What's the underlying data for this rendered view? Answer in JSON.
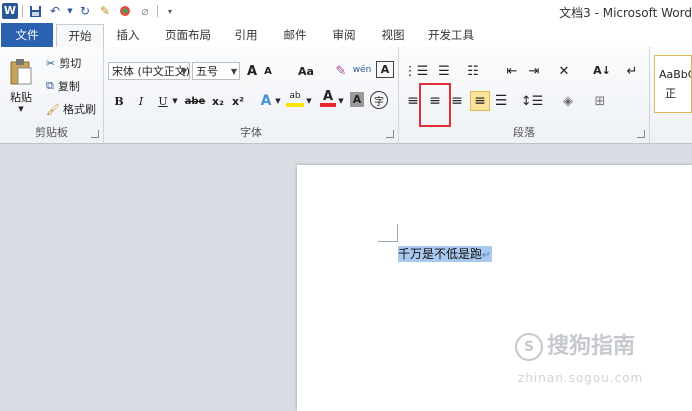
{
  "window": {
    "title": "文档3 - Microsoft Word"
  },
  "qat": {
    "app_icon": "W"
  },
  "tabs": [
    {
      "label": "文件"
    },
    {
      "label": "开始"
    },
    {
      "label": "插入"
    },
    {
      "label": "页面布局"
    },
    {
      "label": "引用"
    },
    {
      "label": "邮件"
    },
    {
      "label": "审阅"
    },
    {
      "label": "视图"
    },
    {
      "label": "开发工具"
    }
  ],
  "clipboard": {
    "paste": "粘贴",
    "cut": "剪切",
    "copy": "复制",
    "format_painter": "格式刷",
    "label": "剪贴板"
  },
  "font": {
    "name": "宋体 (中文正文)",
    "size": "五号",
    "grow": "A",
    "shrink": "A",
    "change_case": "Aa",
    "pinyin": "wén",
    "border_char": "A",
    "bold": "B",
    "italic": "I",
    "underline": "U",
    "strike": "abe",
    "sub": "x₂",
    "sup": "x²",
    "effects": "A",
    "highlight": "ab",
    "color": "A",
    "shade": "A",
    "enclose": "字",
    "label": "字体"
  },
  "paragraph": {
    "label": "段落"
  },
  "styles": {
    "preview": "AaBbC",
    "name": "正"
  },
  "document": {
    "text": "千万是不低是跑"
  },
  "watermark": {
    "brand": "搜狗指南",
    "url": "zhinan.sogou.com"
  }
}
